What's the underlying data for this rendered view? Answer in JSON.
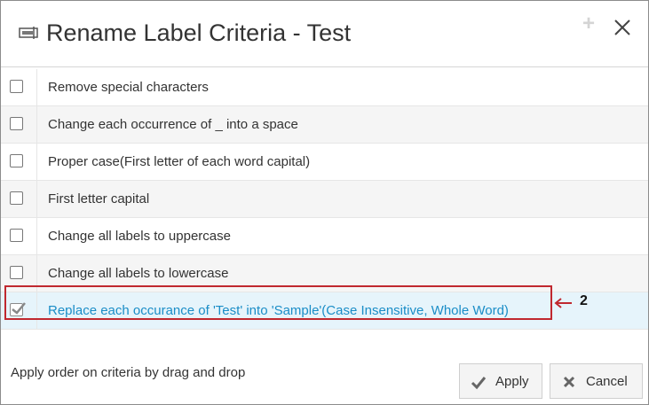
{
  "dialog": {
    "title": "Rename Label Criteria - Test",
    "plus_symbol": "+"
  },
  "criteria": [
    {
      "label": "Remove special characters",
      "checked": false
    },
    {
      "label": "Change each occurrence of _ into a space",
      "checked": false
    },
    {
      "label": "Proper case(First letter of each word capital)",
      "checked": false
    },
    {
      "label": "First letter capital",
      "checked": false
    },
    {
      "label": "Change all labels to uppercase",
      "checked": false
    },
    {
      "label": "Change all labels to lowercase",
      "checked": false
    },
    {
      "label": "Replace each occurance of 'Test' into 'Sample'(Case Insensitive, Whole Word)",
      "checked": true
    }
  ],
  "annotation": {
    "callout_number": "2",
    "highlight_color": "#c0282f"
  },
  "footer": {
    "hint": "Apply order on criteria by drag and drop",
    "apply_label": "Apply",
    "cancel_label": "Cancel"
  },
  "colors": {
    "accent": "#1a8dc7",
    "selected_row_bg": "#e6f4fb"
  }
}
